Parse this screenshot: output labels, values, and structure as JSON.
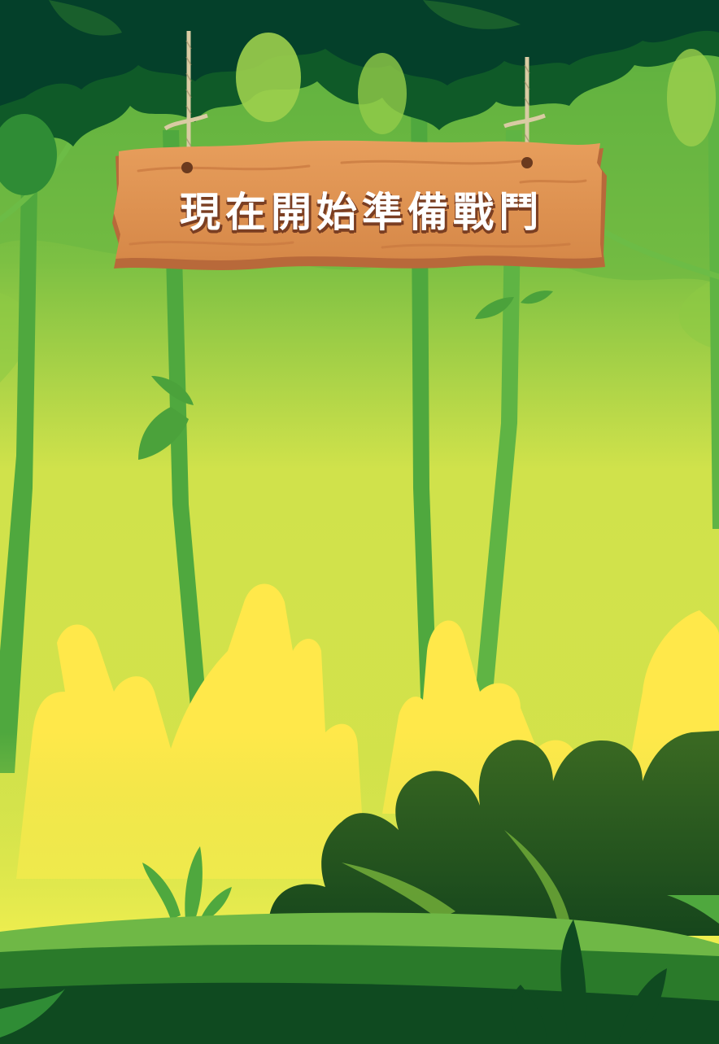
{
  "sign": {
    "title": "現在開始準備戰鬥"
  },
  "colors": {
    "sky_top": "#5db045",
    "sky_bottom": "#d6e24a",
    "canopy_dark": "#003d26",
    "canopy_mid": "#0f5a28",
    "bamboo": "#4fa83e",
    "flame_yellow": "#ffe84a",
    "bush_dark": "#2f5d1f",
    "ground_light": "#6fb846",
    "ground_mid": "#2a7a2a",
    "ground_dark": "#0f4a20",
    "wood": "#de9250",
    "wood_dark": "#b8693a",
    "rope": "#d9cba3"
  }
}
